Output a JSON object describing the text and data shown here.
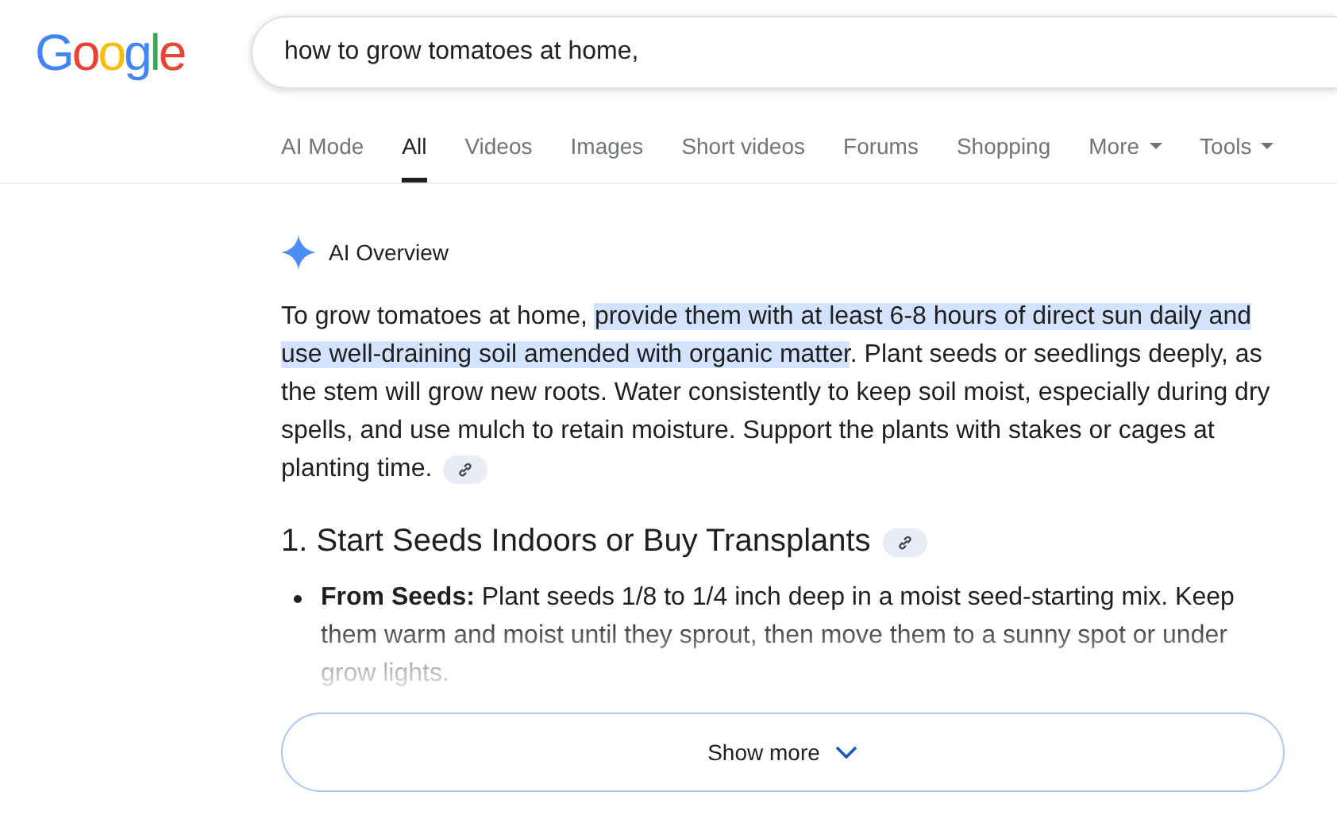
{
  "logo": {
    "text": "Google"
  },
  "search": {
    "value": "how to grow tomatoes at home,"
  },
  "tabs": [
    {
      "label": "AI Mode",
      "selected": false,
      "dropdown": false
    },
    {
      "label": "All",
      "selected": true,
      "dropdown": false
    },
    {
      "label": "Videos",
      "selected": false,
      "dropdown": false
    },
    {
      "label": "Images",
      "selected": false,
      "dropdown": false
    },
    {
      "label": "Short videos",
      "selected": false,
      "dropdown": false
    },
    {
      "label": "Forums",
      "selected": false,
      "dropdown": false
    },
    {
      "label": "Shopping",
      "selected": false,
      "dropdown": false
    },
    {
      "label": "More",
      "selected": false,
      "dropdown": true
    },
    {
      "label": "Tools",
      "selected": false,
      "dropdown": true
    }
  ],
  "overview": {
    "title": "AI Overview",
    "paragraph": [
      {
        "text": "To grow tomatoes at home, ",
        "highlighted": false
      },
      {
        "text": "provide them with at least 6-8 hours of direct sun daily and use well-draining soil amended with organic matter",
        "highlighted": true
      },
      {
        "text": ". Plant seeds or seedlings deeply, as the stem will grow new roots. Water consistently to keep soil moist, especially during dry spells, and use mulch to retain moisture. Support the plants with stakes or cages at planting time.",
        "highlighted": false
      }
    ],
    "heading": "1. Start Seeds Indoors or Buy Transplants",
    "bullets": [
      {
        "text": "**From Seeds:** Plant seeds 1/8 to 1/4 inch deep in a moist seed-starting mix. Keep them warm and moist until they sprout, then move them to a sunny spot or under grow lights."
      }
    ],
    "show_more": "Show more"
  }
}
